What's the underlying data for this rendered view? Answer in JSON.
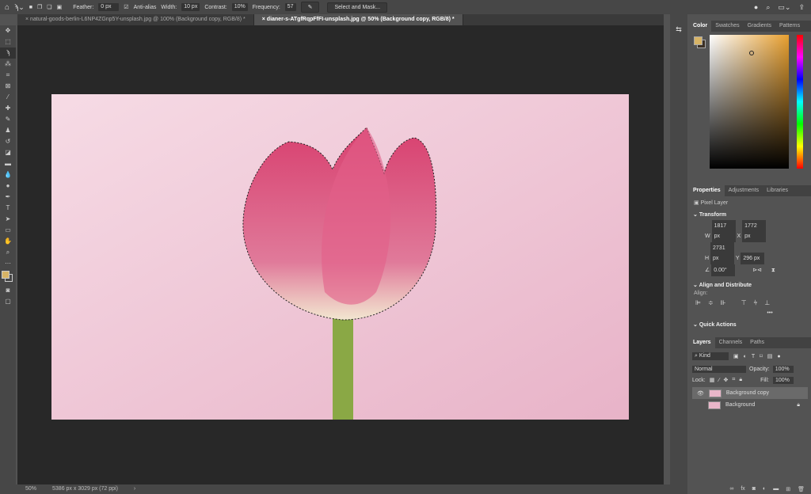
{
  "options": {
    "feather_label": "Feather:",
    "feather": "0 px",
    "antialias": "Anti-alias",
    "width_label": "Width:",
    "width": "10 px",
    "contrast_label": "Contrast:",
    "contrast": "10%",
    "frequency_label": "Frequency:",
    "frequency": "57",
    "select_mask": "Select and Mask..."
  },
  "tabs": [
    {
      "label": "natural-goods-berlin-L6NP4ZGnp5Y-unsplash.jpg @ 100% (Background copy, RGB/8) *"
    },
    {
      "label": "dianer-s-ATgfRqpFfFI-unsplash.jpg @ 50% (Background copy, RGB/8) *"
    }
  ],
  "status": {
    "zoom": "50%",
    "size": "5386 px x 3029 px (72 ppi)"
  },
  "color_panel": {
    "tabs": [
      "Color",
      "Swatches",
      "Gradients",
      "Patterns"
    ],
    "fg": "#d8b466",
    "bg": "#3b3024"
  },
  "properties": {
    "tabs": [
      "Properties",
      "Adjustments",
      "Libraries"
    ],
    "kind": "Pixel Layer",
    "transform": "Transform",
    "w_label": "W",
    "w": "1817 px",
    "x_label": "X",
    "x": "1772 px",
    "h_label": "H",
    "h": "2731 px",
    "y_label": "Y",
    "y": "296 px",
    "angle": "0.00°",
    "align_title": "Align and Distribute",
    "align_label": "Align:",
    "quick": "Quick Actions"
  },
  "layers": {
    "tabs": [
      "Layers",
      "Channels",
      "Paths"
    ],
    "kind": "Kind",
    "blend": "Normal",
    "opacity_label": "Opacity:",
    "opacity": "100%",
    "lock_label": "Lock:",
    "fill_label": "Fill:",
    "fill": "100%",
    "items": [
      {
        "name": "Background copy"
      },
      {
        "name": "Background"
      }
    ]
  }
}
